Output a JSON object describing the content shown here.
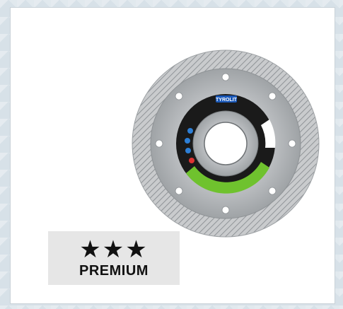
{
  "product_image": {
    "name": "diamond-cutting-disc",
    "brand_label": "TYROLIT"
  },
  "badge": {
    "stars": "★★★",
    "label": "PREMIUM",
    "rating": 3,
    "rating_max": 3
  },
  "colors": {
    "page_background": "#d7e1e8",
    "card_background": "#ffffff",
    "badge_background": "#e6e6e6",
    "blade_steel": "#b9bcbf",
    "label_ring": "#1a1a1a",
    "accent_green": "#6fc22e",
    "accent_blue": "#1a58b8"
  }
}
